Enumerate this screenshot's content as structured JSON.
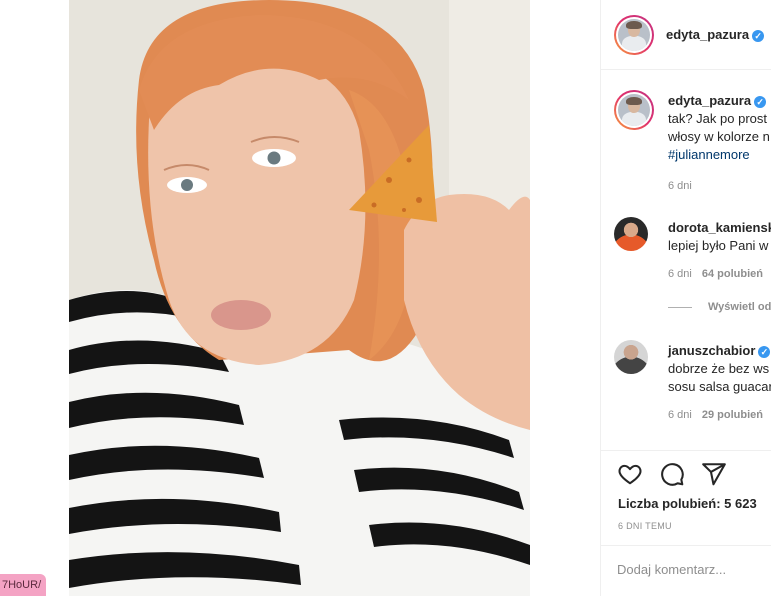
{
  "post": {
    "author": "edyta_pazura",
    "verified_mark": "✓",
    "photo_alt": "Selfie z nachosem"
  },
  "header": {
    "username": "edyta_pazura"
  },
  "caption": {
    "username": "edyta_pazura",
    "line1": "tak? Jak po prost",
    "line2": "włosy w kolorze n",
    "hashtag": "#juliannemore",
    "time": "6 dni"
  },
  "comments": [
    {
      "username": "dorota_kamiensk",
      "text": "lepiej było Pani w",
      "time": "6 dni",
      "likes": "64 polubień",
      "replies": "Wyświetl od"
    },
    {
      "username": "januszchabior",
      "verified": true,
      "line1": "dobrze że bez ws",
      "line2": "sosu salsa guacar",
      "time": "6 dni",
      "likes": "29 polubień"
    }
  ],
  "actions": {
    "like_icon": "heart-icon",
    "comment_icon": "comment-bubble-icon",
    "share_icon": "paper-plane-icon",
    "likes_label": "Liczba polubień: 5 623",
    "time_ago": "6 DNI TEMU"
  },
  "add_comment": {
    "placeholder": "Dodaj komentarz..."
  },
  "corner_tag": {
    "text": "7HoUR/"
  },
  "colors": {
    "accent_link": "#00376b",
    "verified_blue": "#3897f0",
    "muted": "#8e8e8e",
    "corner_tag_bg": "#f4a3c4"
  }
}
